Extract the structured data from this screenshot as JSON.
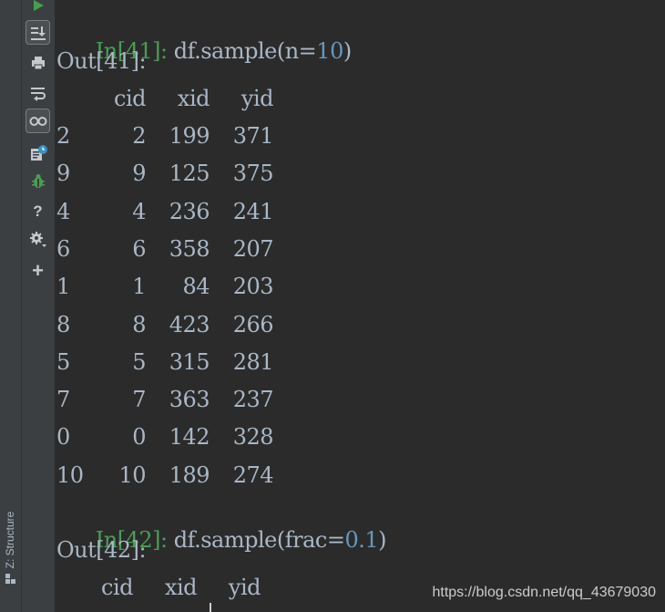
{
  "sidebar": {
    "structure_label": "Z: Structure"
  },
  "toolbar": {
    "icons": [
      "run-icon",
      "scroll-to-end-icon",
      "print-icon",
      "soft-wrap-icon",
      "variables-view-icon",
      "command-history-icon",
      "debug-icon",
      "help-icon",
      "settings-icon",
      "add-icon"
    ],
    "help_label": "?",
    "add_label": "+"
  },
  "console": {
    "cell1": {
      "prompt": "In[41]:",
      "code_pre": "df.sample(n=",
      "code_num": "10",
      "code_post": ")",
      "out_prompt": "Out[41]:",
      "columns": [
        "cid",
        "xid",
        "yid"
      ],
      "rows": [
        {
          "index": "2",
          "cid": "2",
          "xid": "199",
          "yid": "371"
        },
        {
          "index": "9",
          "cid": "9",
          "xid": "125",
          "yid": "375"
        },
        {
          "index": "4",
          "cid": "4",
          "xid": "236",
          "yid": "241"
        },
        {
          "index": "6",
          "cid": "6",
          "xid": "358",
          "yid": "207"
        },
        {
          "index": "1",
          "cid": "1",
          "xid": "84",
          "yid": "203"
        },
        {
          "index": "8",
          "cid": "8",
          "xid": "423",
          "yid": "266"
        },
        {
          "index": "5",
          "cid": "5",
          "xid": "315",
          "yid": "281"
        },
        {
          "index": "7",
          "cid": "7",
          "xid": "363",
          "yid": "237"
        },
        {
          "index": "0",
          "cid": "0",
          "xid": "142",
          "yid": "328"
        },
        {
          "index": "10",
          "cid": "10",
          "xid": "189",
          "yid": "274"
        }
      ]
    },
    "cell2": {
      "prompt": "In[42]:",
      "code_pre": "df.sample(frac=",
      "code_num": "0.1",
      "code_post": ")",
      "out_prompt": "Out[42]:",
      "columns": [
        "cid",
        "xid",
        "yid"
      ]
    }
  },
  "watermark": "https://blog.csdn.net/qq_43679030",
  "colors": {
    "background": "#2b2b2b",
    "toolbar": "#3c3f41",
    "text": "#a9b7c6",
    "prompt": "#499c54",
    "number": "#6897bb"
  }
}
